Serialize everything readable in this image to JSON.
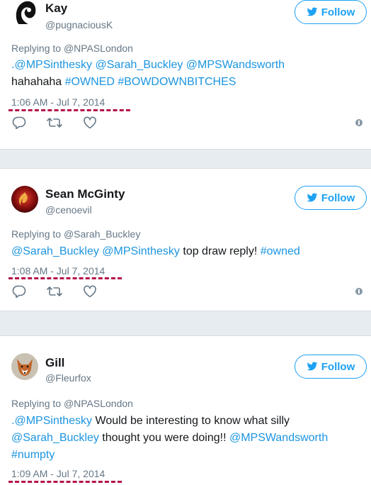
{
  "follow_label": "Follow",
  "tweets": [
    {
      "name": "Kay",
      "handle": "@pugnaciousK",
      "replying_prefix": "Replying to ",
      "replying_to": "@NPASLondon",
      "body": [
        {
          "t": ".@MPSinthesky @Sarah_Buckley @MPSWandsworth",
          "link": true
        },
        {
          "t": "hahahaha ",
          "link": false
        },
        {
          "t": "#OWNED #BOWDOWNBITCHES",
          "link": true
        }
      ],
      "timestamp": "1:06 AM - Jul 7, 2014"
    },
    {
      "name": "Sean McGinty",
      "handle": "@cenoevil",
      "replying_prefix": "Replying to ",
      "replying_to": "@Sarah_Buckley",
      "body": [
        {
          "t": "@Sarah_Buckley @MPSinthesky",
          "link": true
        },
        {
          "t": " top draw reply! ",
          "link": false
        },
        {
          "t": "#owned",
          "link": true
        }
      ],
      "timestamp": "1:08 AM - Jul 7, 2014"
    },
    {
      "name": "Gill",
      "handle": "@Fleurfox",
      "replying_prefix": "Replying to ",
      "replying_to": "@NPASLondon",
      "body": [
        {
          "t": ".@MPSinthesky",
          "link": true
        },
        {
          "t": " Would be interesting to know what silly ",
          "link": false
        },
        {
          "t": "@Sarah_Buckley",
          "link": true
        },
        {
          "t": " thought you were doing!! ",
          "link": false
        },
        {
          "t": "@MPSWandsworth #numpty",
          "link": true
        }
      ],
      "timestamp": "1:09 AM - Jul 7, 2014"
    }
  ],
  "colors": {
    "link": "#1b95e0",
    "follow": "#1da1f2",
    "annotation_dash": "#b5124a",
    "muted": "#657786"
  },
  "icons": [
    "reply-icon",
    "retweet-icon",
    "like-icon",
    "info-icon",
    "twitter-bird-icon"
  ]
}
